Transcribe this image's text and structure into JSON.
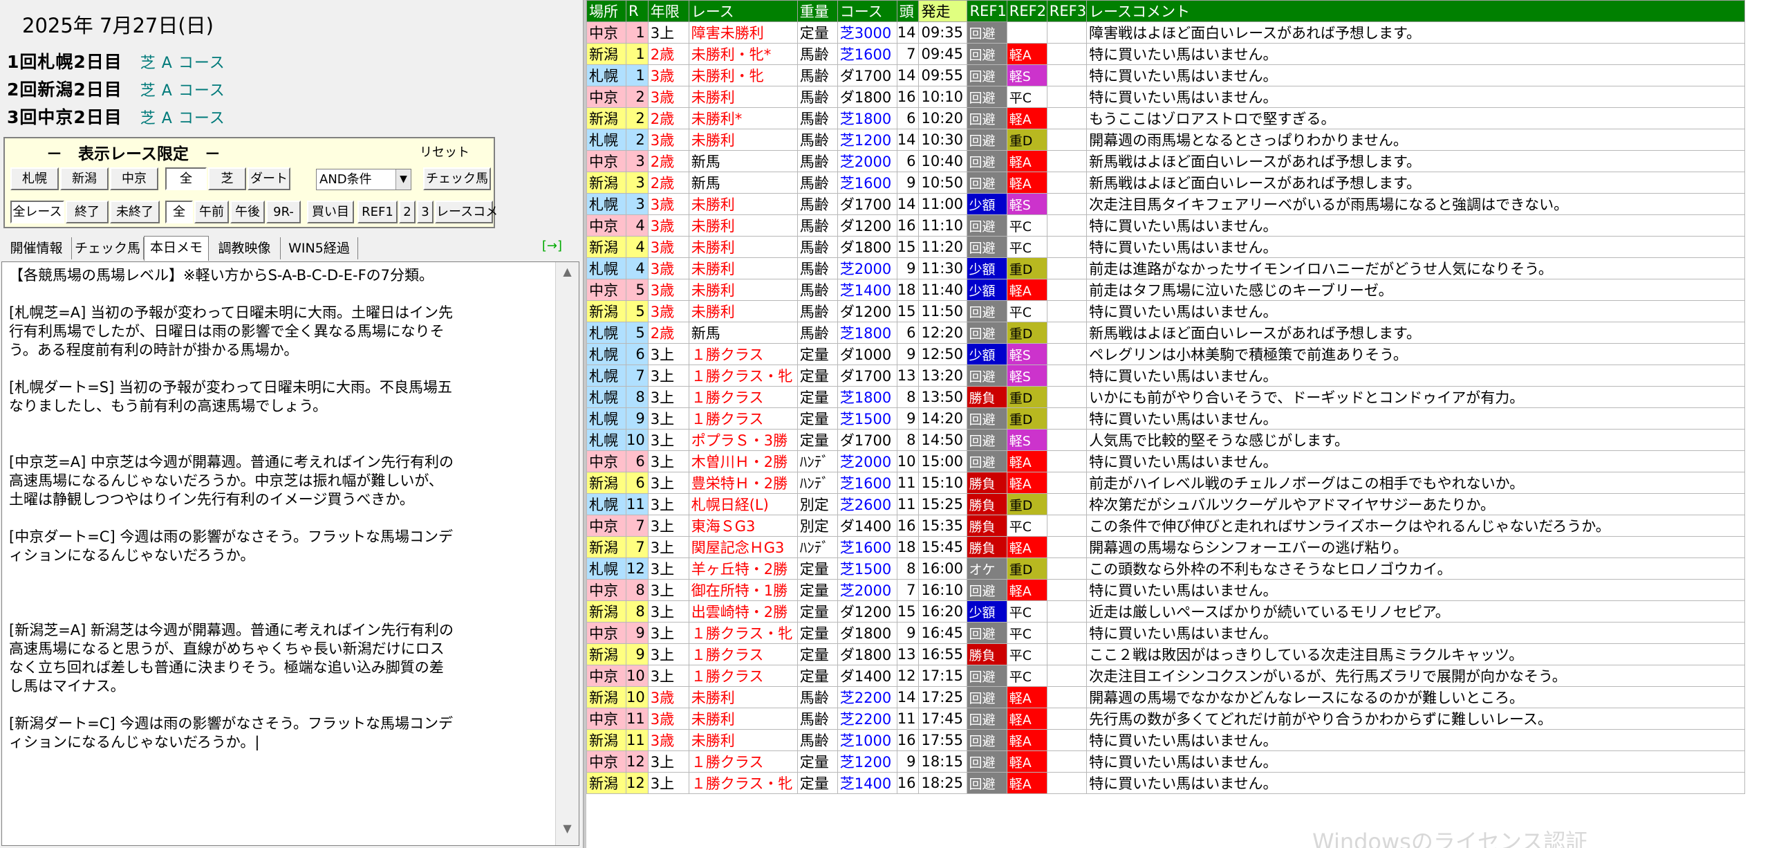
{
  "date": "2025年 7月27日(日)",
  "meetings": [
    {
      "name": "1回札幌2日目",
      "course": "芝 A コース"
    },
    {
      "name": "2回新潟2日目",
      "course": "芝 A コース"
    },
    {
      "name": "3回中京2日目",
      "course": "芝 A コース"
    }
  ],
  "filter": {
    "title": "－　表示レース限定　－",
    "reset": "リセット",
    "venues": [
      "札幌",
      "新潟",
      "中京"
    ],
    "surface": [
      "全",
      "芝",
      "ダート"
    ],
    "condition": "AND条件",
    "check_horse": "チェック馬",
    "status": [
      "全レース",
      "終了",
      "未終了"
    ],
    "time": [
      "全",
      "午前",
      "午後",
      "9R-"
    ],
    "buy": "買い目",
    "refs": [
      "REF1",
      "2",
      "3"
    ],
    "race_comment": "レースコメ"
  },
  "tabs": [
    "開催情報",
    "チェック馬",
    "本日メモ",
    "調教映像",
    "WIN5経過"
  ],
  "tab_extra": "[→]",
  "memo": "【各競馬場の馬場レベル】※軽い方からS-A-B-C-D-E-Fの7分類。\n\n[札幌芝=A] 当初の予報が変わって日曜未明に大雨。土曜日はイン先\n行有利馬場でしたが、日曜日は雨の影響で全く異なる馬場になりそ\nう。ある程度前有利の時計が掛かる馬場か。\n\n[札幌ダート=S] 当初の予報が変わって日曜未明に大雨。不良馬場五\nなりましたし、もう前有利の高速馬場でしょう。\n\n\n[中京芝=A] 中京芝は今週が開幕週。普通に考えればイン先行有利の\n高速馬場になるんじゃないだろうか。中京芝は振れ幅が難しいが、\n土曜は静観しつつやはりイン先行有利のイメージ買うべきか。\n\n[中京ダート=C] 今週は雨の影響がなさそう。フラットな馬場コンデ\nィションになるんじゃないだろうか。\n\n\n\n[新潟芝=A] 新潟芝は今週が開幕週。普通に考えればイン先行有利の\n高速馬場になると思うが、直線がめちゃくちゃ長い新潟だけにロス\nなく立ち回れば差しも普通に決まりそう。極端な追い込み脚質の差\nし馬はマイナス。\n\n[新潟ダート=C] 今週は雨の影響がなさそう。フラットな馬場コンデ\nィションになるんじゃないだろうか。|",
  "table": {
    "headers": [
      "場所",
      "R",
      "年限",
      "レース",
      "重量",
      "コース",
      "頭",
      "発走",
      "REF1",
      "REF2",
      "REF3",
      "レースコメント"
    ],
    "rows": [
      [
        "中京",
        "1",
        "3上",
        "障害未勝利",
        "定量",
        "芝3000",
        "14",
        "09:35",
        "回避",
        "",
        "",
        "障害戦はよほど面白いレースがあれば予想します。"
      ],
      [
        "新潟",
        "1",
        "2歳",
        "未勝利・牝*",
        "馬齢",
        "芝1600",
        "7",
        "09:45",
        "回避",
        "軽A",
        "",
        "特に買いたい馬はいません。"
      ],
      [
        "札幌",
        "1",
        "3歳",
        "未勝利・牝",
        "馬齢",
        "ダ1700",
        "14",
        "09:55",
        "回避",
        "軽S",
        "",
        "特に買いたい馬はいません。"
      ],
      [
        "中京",
        "2",
        "3歳",
        "未勝利",
        "馬齢",
        "ダ1800",
        "16",
        "10:10",
        "回避",
        "平C",
        "",
        "特に買いたい馬はいません。"
      ],
      [
        "新潟",
        "2",
        "2歳",
        "未勝利*",
        "馬齢",
        "芝1800",
        "6",
        "10:20",
        "回避",
        "軽A",
        "",
        "もうここはゾロアストロで堅すぎる。"
      ],
      [
        "札幌",
        "2",
        "3歳",
        "未勝利",
        "馬齢",
        "芝1200",
        "14",
        "10:30",
        "回避",
        "重D",
        "",
        "開幕週の雨馬場となるとさっぱりわかりません。"
      ],
      [
        "中京",
        "3",
        "2歳",
        "新馬",
        "馬齢",
        "芝2000",
        "6",
        "10:40",
        "回避",
        "軽A",
        "",
        "新馬戦はよほど面白いレースがあれば予想します。"
      ],
      [
        "新潟",
        "3",
        "2歳",
        "新馬",
        "馬齢",
        "芝1600",
        "9",
        "10:50",
        "回避",
        "軽A",
        "",
        "新馬戦はよほど面白いレースがあれば予想します。"
      ],
      [
        "札幌",
        "3",
        "3歳",
        "未勝利",
        "馬齢",
        "ダ1700",
        "14",
        "11:00",
        "少額",
        "軽S",
        "",
        "次走注目馬タイキフェアリーベがいるが雨馬場になると強調はできない。"
      ],
      [
        "中京",
        "4",
        "3歳",
        "未勝利",
        "馬齢",
        "ダ1200",
        "16",
        "11:10",
        "回避",
        "平C",
        "",
        "特に買いたい馬はいません。"
      ],
      [
        "新潟",
        "4",
        "3歳",
        "未勝利",
        "馬齢",
        "ダ1800",
        "15",
        "11:20",
        "回避",
        "平C",
        "",
        "特に買いたい馬はいません。"
      ],
      [
        "札幌",
        "4",
        "3歳",
        "未勝利",
        "馬齢",
        "芝2000",
        "9",
        "11:30",
        "少額",
        "重D",
        "",
        "前走は進路がなかったサイモンイロハニーだがどうせ人気になりそう。"
      ],
      [
        "中京",
        "5",
        "3歳",
        "未勝利",
        "馬齢",
        "芝1400",
        "18",
        "11:40",
        "少額",
        "軽A",
        "",
        "前走はタフ馬場に泣いた感じのキーブリーゼ。"
      ],
      [
        "新潟",
        "5",
        "3歳",
        "未勝利",
        "馬齢",
        "ダ1200",
        "15",
        "11:50",
        "回避",
        "平C",
        "",
        "特に買いたい馬はいません。"
      ],
      [
        "札幌",
        "5",
        "2歳",
        "新馬",
        "馬齢",
        "芝1800",
        "6",
        "12:20",
        "回避",
        "重D",
        "",
        "新馬戦はよほど面白いレースがあれば予想します。"
      ],
      [
        "札幌",
        "6",
        "3上",
        "１勝クラス",
        "定量",
        "ダ1000",
        "9",
        "12:50",
        "少額",
        "軽S",
        "",
        "ペレグリンは小林美駒で積極策で前進ありそう。"
      ],
      [
        "札幌",
        "7",
        "3上",
        "１勝クラス・牝",
        "定量",
        "ダ1700",
        "13",
        "13:20",
        "回避",
        "軽S",
        "",
        "特に買いたい馬はいません。"
      ],
      [
        "札幌",
        "8",
        "3上",
        "１勝クラス",
        "定量",
        "芝1800",
        "8",
        "13:50",
        "勝負",
        "重D",
        "",
        "いかにも前がやり合いそうで、ドーギッドとコンドゥイアが有力。"
      ],
      [
        "札幌",
        "9",
        "3上",
        "１勝クラス",
        "定量",
        "芝1500",
        "9",
        "14:20",
        "回避",
        "重D",
        "",
        "特に買いたい馬はいません。"
      ],
      [
        "札幌",
        "10",
        "3上",
        "ポプラＳ・3勝",
        "定量",
        "ダ1700",
        "8",
        "14:50",
        "回避",
        "軽S",
        "",
        "人気馬で比較的堅そうな感じがします。"
      ],
      [
        "中京",
        "6",
        "3上",
        "木曽川Ｈ・2勝",
        "ﾊﾝﾃﾞ",
        "芝2000",
        "10",
        "15:00",
        "回避",
        "軽A",
        "",
        "特に買いたい馬はいません。"
      ],
      [
        "新潟",
        "6",
        "3上",
        "豊栄特Ｈ・2勝",
        "ﾊﾝﾃﾞ",
        "芝1600",
        "11",
        "15:10",
        "勝負",
        "軽A",
        "",
        "前走がハイレベル戦のチェルノボーグはこの相手でもやれないか。"
      ],
      [
        "札幌",
        "11",
        "3上",
        "札幌日経(L)",
        "別定",
        "芝2600",
        "11",
        "15:25",
        "勝負",
        "重D",
        "",
        "枠次第だがシュバルツクーゲルやアドマイヤサジーあたりか。"
      ],
      [
        "中京",
        "7",
        "3上",
        "東海ＳG3",
        "別定",
        "ダ1400",
        "16",
        "15:35",
        "勝負",
        "平C",
        "",
        "この条件で伸び伸びと走れればサンライズホークはやれるんじゃないだろうか。"
      ],
      [
        "新潟",
        "7",
        "3上",
        "関屋記念ＨG3",
        "ﾊﾝﾃﾞ",
        "芝1600",
        "18",
        "15:45",
        "勝負",
        "軽A",
        "",
        "開幕週の馬場ならシンフォーエバーの逃げ粘り。"
      ],
      [
        "札幌",
        "12",
        "3上",
        "羊ヶ丘特・2勝",
        "定量",
        "芝1500",
        "8",
        "16:00",
        "オケ",
        "重D",
        "",
        "この頭数なら外枠の不利もなさそうなヒロノゴウカイ。"
      ],
      [
        "中京",
        "8",
        "3上",
        "御在所特・1勝",
        "定量",
        "芝2000",
        "7",
        "16:10",
        "回避",
        "軽A",
        "",
        "特に買いたい馬はいません。"
      ],
      [
        "新潟",
        "8",
        "3上",
        "出雲崎特・2勝",
        "定量",
        "ダ1200",
        "15",
        "16:20",
        "少額",
        "平C",
        "",
        "近走は厳しいペースばかりが続いているモリノセピア。"
      ],
      [
        "中京",
        "9",
        "3上",
        "１勝クラス・牝",
        "定量",
        "ダ1800",
        "9",
        "16:45",
        "回避",
        "平C",
        "",
        "特に買いたい馬はいません。"
      ],
      [
        "新潟",
        "9",
        "3上",
        "１勝クラス",
        "定量",
        "ダ1800",
        "13",
        "16:55",
        "勝負",
        "平C",
        "",
        "ここ２戦は敗因がはっきりしている次走注目馬ミラクルキャッツ。"
      ],
      [
        "中京",
        "10",
        "3上",
        "１勝クラス",
        "定量",
        "ダ1400",
        "12",
        "17:15",
        "回避",
        "平C",
        "",
        "次走注目エイシンコクスンがいるが、先行馬ズラリで展開が向かなそう。"
      ],
      [
        "新潟",
        "10",
        "3歳",
        "未勝利",
        "馬齢",
        "芝2200",
        "14",
        "17:25",
        "回避",
        "軽A",
        "",
        "開幕週の馬場でなかなかどんなレースになるのかが難しいところ。"
      ],
      [
        "中京",
        "11",
        "3歳",
        "未勝利",
        "馬齢",
        "芝2200",
        "11",
        "17:45",
        "回避",
        "軽A",
        "",
        "先行馬の数が多くてどれだけ前がやり合うかわからずに難しいレース。"
      ],
      [
        "新潟",
        "11",
        "3歳",
        "未勝利",
        "馬齢",
        "芝1000",
        "16",
        "17:55",
        "回避",
        "軽A",
        "",
        "特に買いたい馬はいません。"
      ],
      [
        "中京",
        "12",
        "3上",
        "１勝クラス",
        "定量",
        "芝1200",
        "9",
        "18:15",
        "回避",
        "軽A",
        "",
        "特に買いたい馬はいません。"
      ],
      [
        "新潟",
        "12",
        "3上",
        "１勝クラス・牝",
        "定量",
        "芝1400",
        "16",
        "18:25",
        "回避",
        "軽A",
        "",
        "特に買いたい馬はいません。"
      ]
    ]
  },
  "watermark": "Windowsのライセンス認証",
  "colors": {
    "header_green": "#008000",
    "chukyo_bg": "#ffc0cb",
    "niigata_bg": "#ffff80",
    "sapporo_bg": "#b0e0ff",
    "red_text": "#ff0000",
    "turf_text": "#0000ff"
  }
}
